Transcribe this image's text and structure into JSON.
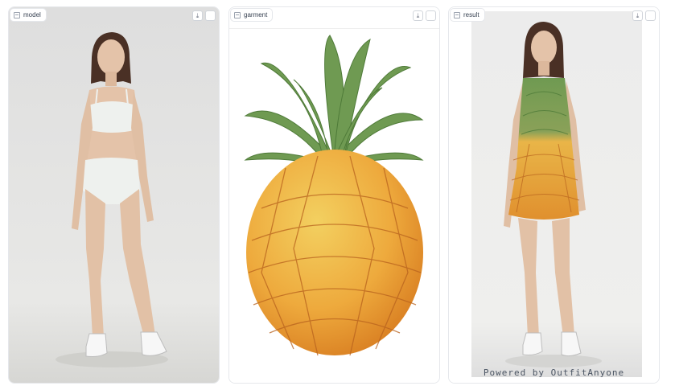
{
  "panels": {
    "model": {
      "label": "model"
    },
    "garment": {
      "label": "garment"
    },
    "result": {
      "label": "result"
    }
  },
  "icons": {
    "image": "image-icon",
    "download": "download-icon",
    "fullscreen": "fullscreen-icon"
  },
  "download_glyph": "⤓",
  "result_watermark": "Powered by OutfitAnyone",
  "colors": {
    "skin": "#e4c3a9",
    "hair": "#4a3025",
    "underwear": "#eef1ee",
    "pineapple_leaf": "#6f9a52",
    "pineapple_body": "#eeaa3d"
  }
}
